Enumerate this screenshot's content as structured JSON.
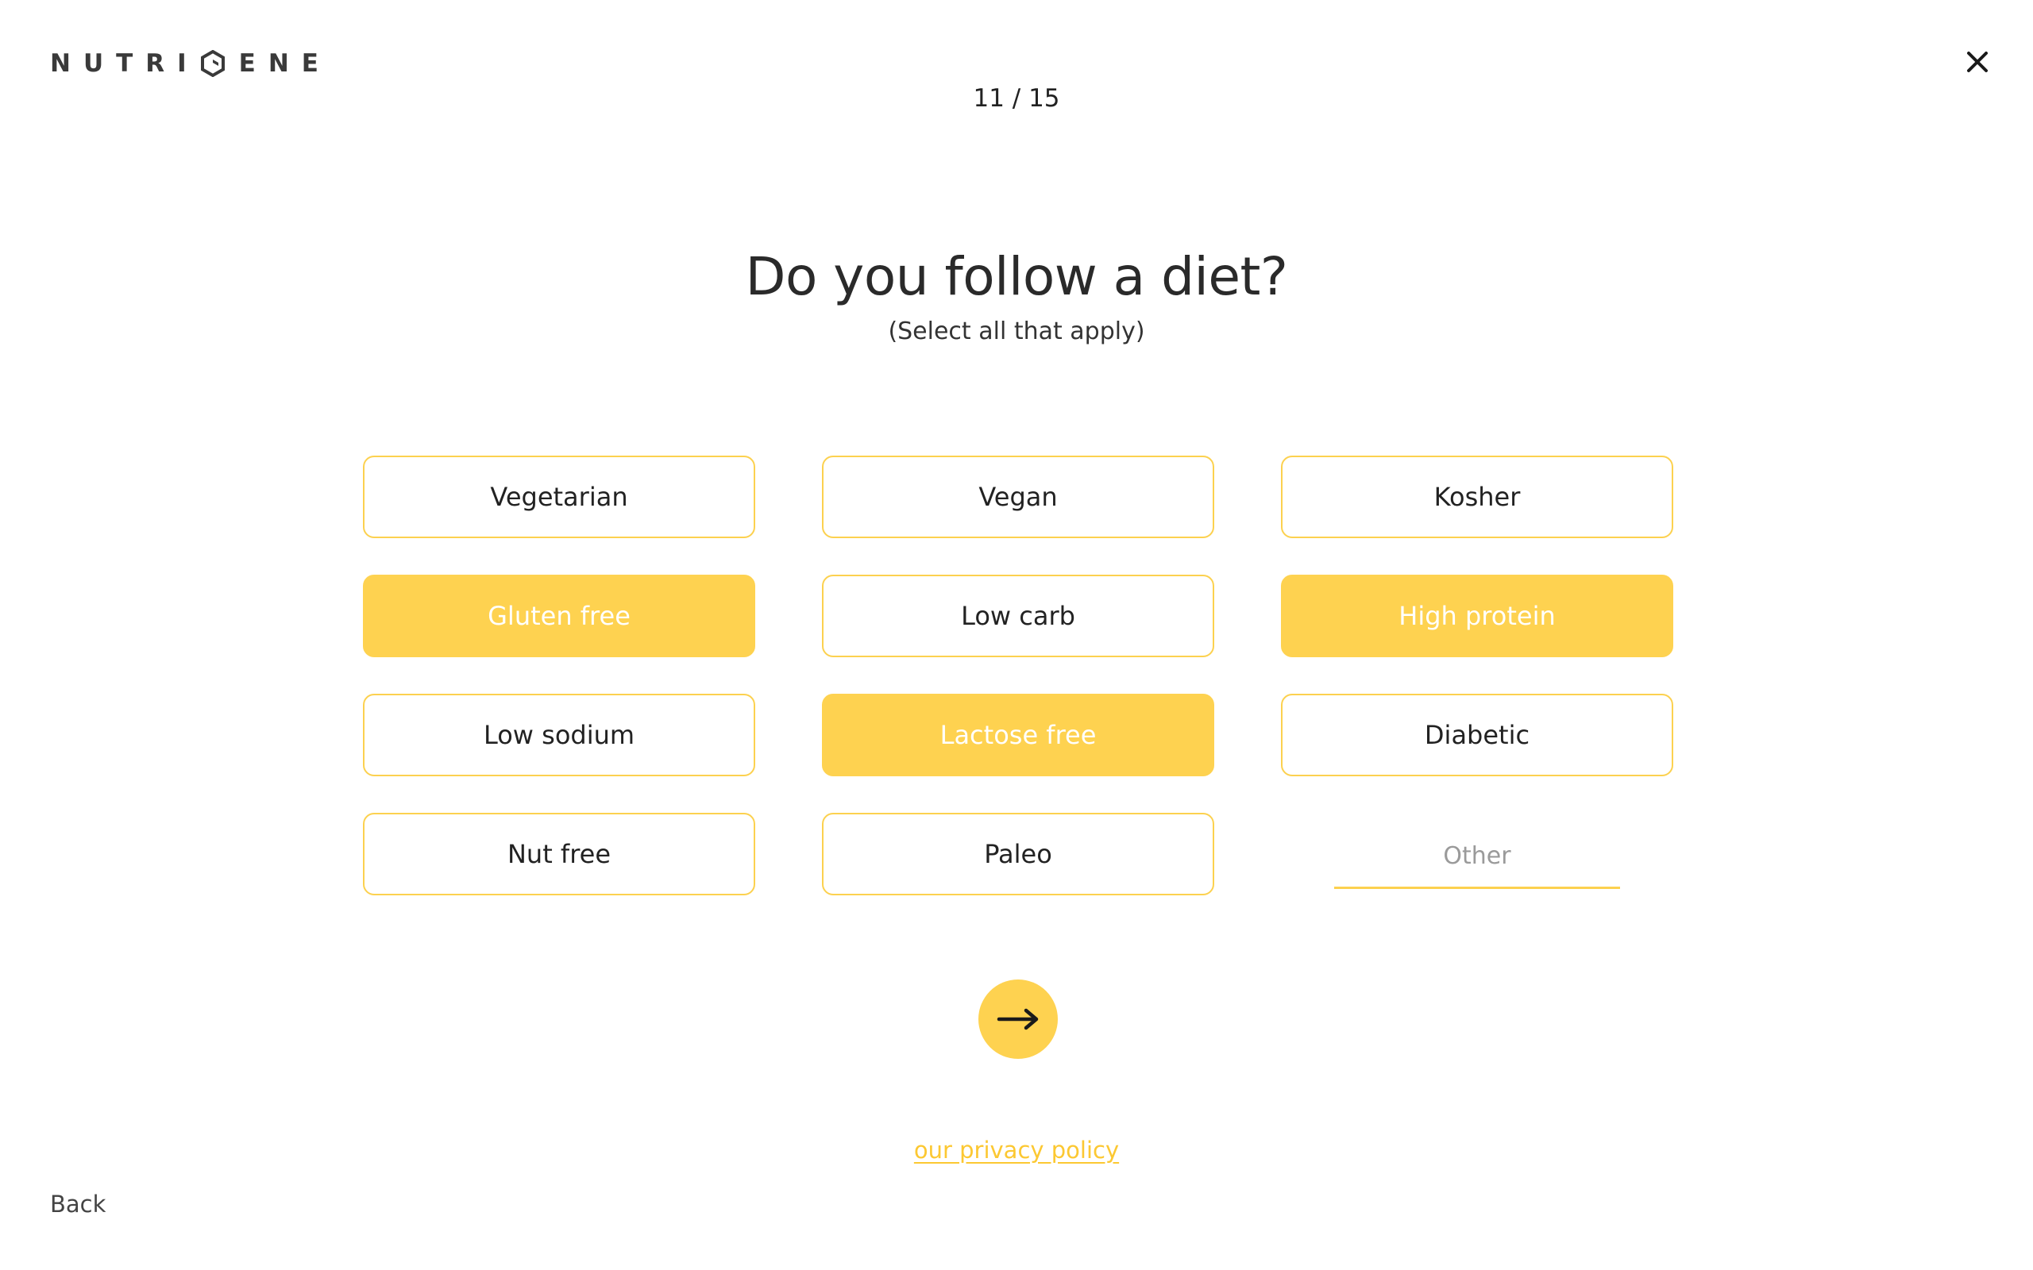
{
  "brand": {
    "logo_left": "NUTRI",
    "logo_right": "ENE",
    "logo_mark_icon": "g-hexagon-logo-icon"
  },
  "header": {
    "progress": "11 / 15",
    "close_icon": "close-icon"
  },
  "question": {
    "title": "Do you follow a diet?",
    "subtitle": "(Select all that apply)"
  },
  "options": [
    {
      "label": "Vegetarian",
      "selected": false
    },
    {
      "label": "Vegan",
      "selected": false
    },
    {
      "label": "Kosher",
      "selected": false
    },
    {
      "label": "Gluten free",
      "selected": true
    },
    {
      "label": "Low carb",
      "selected": false
    },
    {
      "label": "High protein",
      "selected": true
    },
    {
      "label": "Low sodium",
      "selected": false
    },
    {
      "label": "Lactose free",
      "selected": true
    },
    {
      "label": "Diabetic",
      "selected": false
    },
    {
      "label": "Nut free",
      "selected": false
    },
    {
      "label": "Paleo",
      "selected": false
    }
  ],
  "other": {
    "placeholder": "Other",
    "value": ""
  },
  "next_button": {
    "icon": "arrow-right-icon"
  },
  "footer": {
    "privacy_link": "our privacy policy",
    "back_label": "Back"
  },
  "colors": {
    "accent": "#fed250",
    "accent_border": "#fcd14f",
    "link": "#fcc832",
    "text": "#222222"
  }
}
